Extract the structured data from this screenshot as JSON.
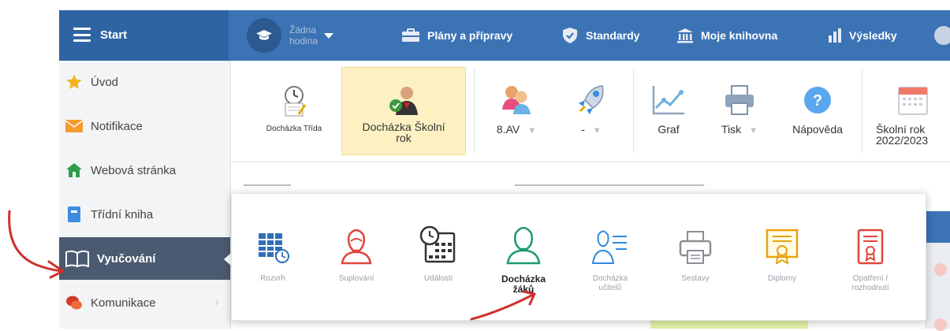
{
  "topbar": {
    "start_label": "Start",
    "hodina_label_line1": "Žádna",
    "hodina_label_line2": "hodina",
    "items": [
      {
        "label": "Plány a přípravy",
        "icon": "briefcase-icon"
      },
      {
        "label": "Standardy",
        "icon": "shield-check-icon"
      },
      {
        "label": "Moje knihovna",
        "icon": "library-icon"
      },
      {
        "label": "Výsledky",
        "icon": "bar-chart-icon"
      }
    ]
  },
  "sidebar": {
    "items": [
      {
        "label": "Úvod",
        "icon": "star-icon",
        "color": "#f5b21b"
      },
      {
        "label": "Notifikace",
        "icon": "envelope-icon",
        "color": "#f59a2c"
      },
      {
        "label": "Webová stránka",
        "icon": "house-icon",
        "color": "#2e9d4a"
      },
      {
        "label": "Třídní kniha",
        "icon": "book-icon",
        "color": "#3a8de0"
      },
      {
        "label": "Vyučování",
        "icon": "open-book-icon",
        "active": true
      },
      {
        "label": "Komunikace",
        "icon": "chat-bubbles-icon",
        "color": "#d23a2a"
      }
    ]
  },
  "toolbar": {
    "dochazka_trida": "Docházka Třída",
    "dochazka_skolni_line1": "Docházka Školní",
    "dochazka_skolni_line2": "rok",
    "class_select": "8.AV",
    "dash_select": "-",
    "graf": "Graf",
    "tisk": "Tisk",
    "napoveda": "Nápověda",
    "skolni_rok_line1": "Školní rok",
    "skolni_rok_line2": "2022/2023"
  },
  "submenu": {
    "items": [
      {
        "label": "Rozvrh",
        "icon": "timetable-icon"
      },
      {
        "label": "Suplování",
        "icon": "substitute-icon"
      },
      {
        "label": "Události",
        "icon": "calendar-clock-icon"
      },
      {
        "label_line1": "Docházka",
        "label_line2": "žáků",
        "icon": "student-icon",
        "selected": true
      },
      {
        "label_line1": "Docházka",
        "label_line2": "učitelů",
        "icon": "teacher-list-icon"
      },
      {
        "label": "Sestavy",
        "icon": "printer-icon"
      },
      {
        "label": "Diplomy",
        "icon": "diploma-icon"
      },
      {
        "label_line1": "Opatření /",
        "label_line2": "rozhodnutí",
        "icon": "decision-doc-icon"
      }
    ]
  },
  "colors": {
    "topbar": "#3b73b5",
    "sidebar_active": "#4a5a70",
    "highlight": "#fdf1c4",
    "annotation_arrow": "#d0312d"
  }
}
